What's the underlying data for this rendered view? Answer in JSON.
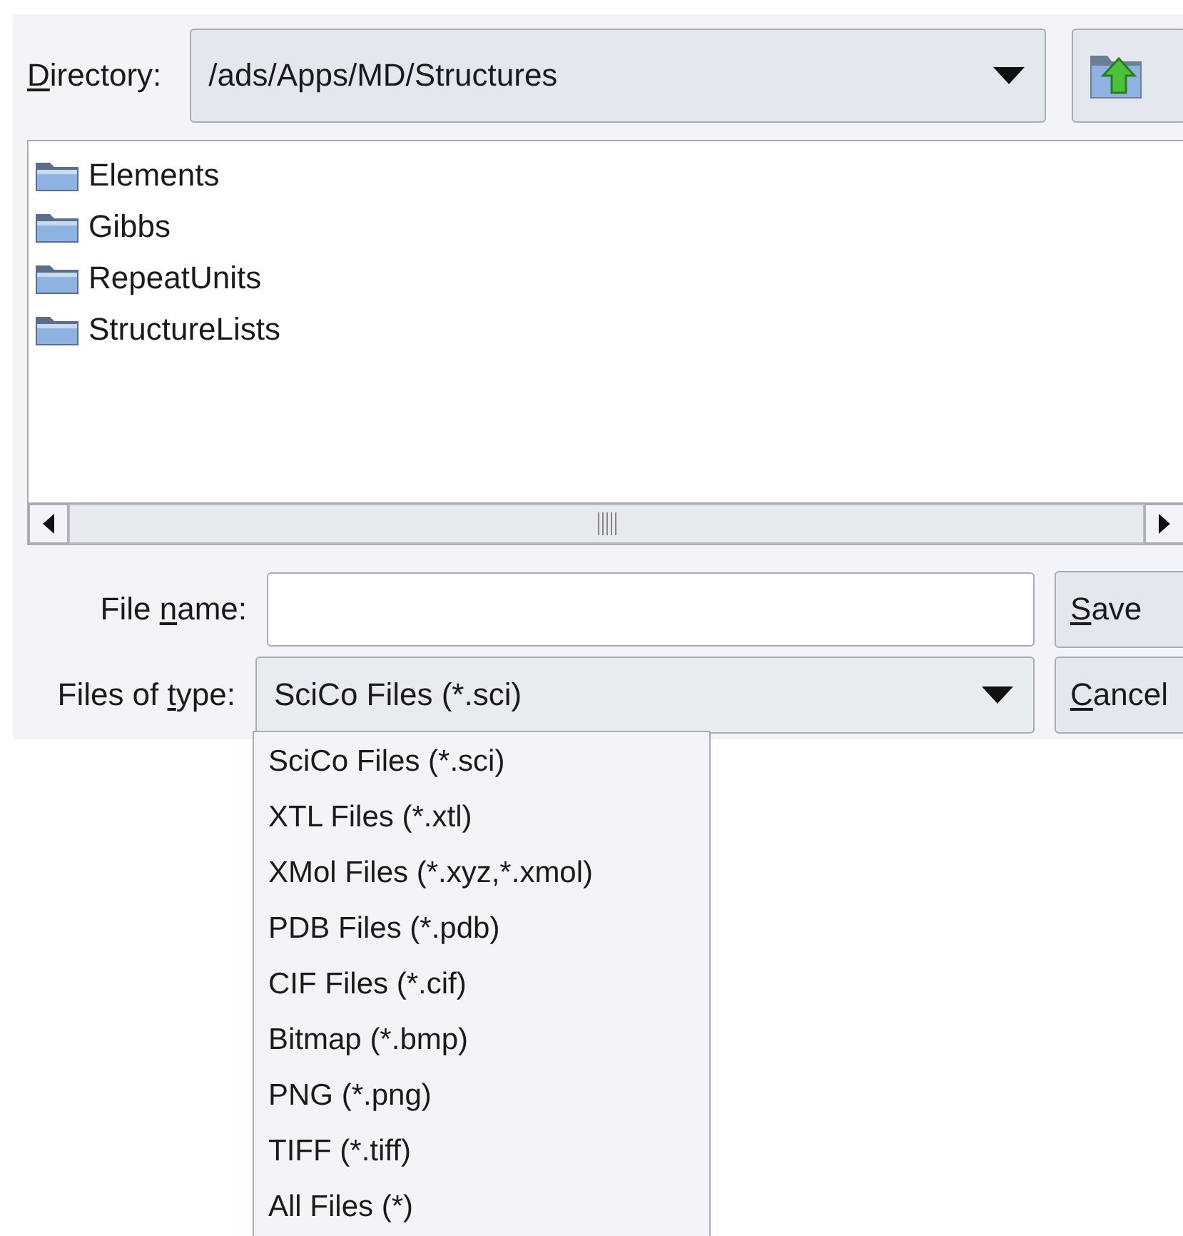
{
  "directory": {
    "label": {
      "mnemonic": "D",
      "after": "irectory:"
    },
    "value": "/ads/Apps/MD/Structures"
  },
  "files": [
    {
      "name": "Elements",
      "kind": "folder"
    },
    {
      "name": "Gibbs",
      "kind": "folder"
    },
    {
      "name": "RepeatUnits",
      "kind": "folder"
    },
    {
      "name": "StructureLists",
      "kind": "folder"
    }
  ],
  "file_name": {
    "label": {
      "before": "File ",
      "mnemonic": "n",
      "after": "ame:"
    }
  },
  "file_type": {
    "label": {
      "before": "Files of ",
      "mnemonic": "t",
      "after": "ype:"
    },
    "value": "SciCo Files (*.sci)"
  },
  "buttons": [
    {
      "mnemonic": "S",
      "after": "ave"
    },
    {
      "mnemonic": "C",
      "after": "ancel"
    }
  ],
  "type_options": [
    {
      "label": "SciCo Files (*.sci)",
      "selected": false
    },
    {
      "label": "XTL Files (*.xtl)",
      "selected": false
    },
    {
      "label": "XMol Files (*.xyz,*.xmol)",
      "selected": false
    },
    {
      "label": "PDB Files (*.pdb)",
      "selected": false
    },
    {
      "label": "CIF Files (*.cif)",
      "selected": false
    },
    {
      "label": "Bitmap (*.bmp)",
      "selected": false
    },
    {
      "label": "PNG (*.png)",
      "selected": false
    },
    {
      "label": "TIFF (*.tiff)",
      "selected": false
    },
    {
      "label": "All Files (*)",
      "selected": false
    }
  ]
}
